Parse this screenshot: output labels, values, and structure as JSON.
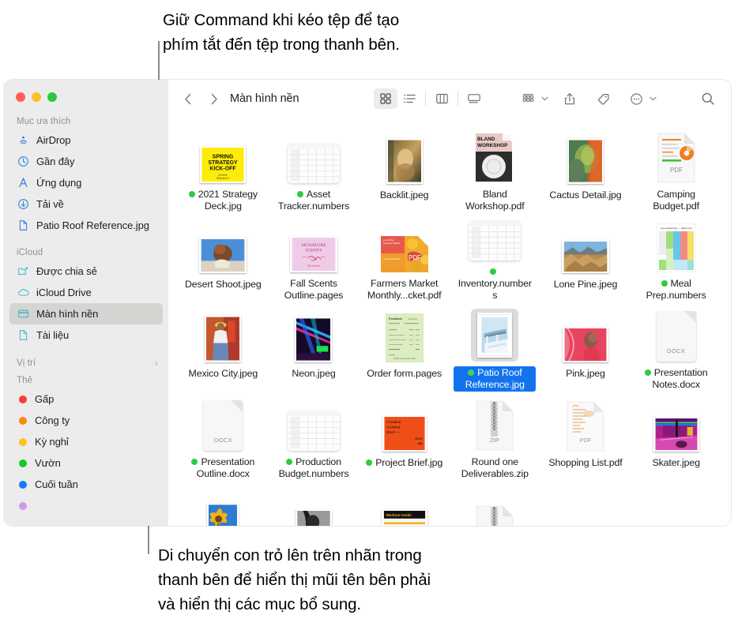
{
  "callouts": {
    "top": "Giữ Command khi kéo tệp để tạo\nphím tắt đến tệp trong thanh bên.",
    "bottom": "Di chuyển con trỏ lên trên nhãn trong\nthanh bên để hiển thị mũi tên bên phải\nvà hiển thị các mục bổ sung."
  },
  "window": {
    "traffic_lights": [
      "close",
      "minimize",
      "zoom"
    ]
  },
  "sidebar": {
    "sections": [
      {
        "header": "Mục ưa thích",
        "has_chevron": false,
        "items": [
          {
            "label": "AirDrop",
            "icon": "airdrop-icon",
            "selected": false
          },
          {
            "label": "Gần đây",
            "icon": "clock-icon",
            "selected": false
          },
          {
            "label": "Ứng dụng",
            "icon": "applications-icon",
            "selected": false
          },
          {
            "label": "Tải về",
            "icon": "downloads-icon",
            "selected": false
          },
          {
            "label": "Patio Roof Reference.jpg",
            "icon": "document-icon",
            "selected": false
          }
        ]
      },
      {
        "header": "iCloud",
        "has_chevron": false,
        "items": [
          {
            "label": "Được chia sẻ",
            "icon": "shared-folder-icon",
            "selected": false
          },
          {
            "label": "iCloud Drive",
            "icon": "cloud-icon",
            "selected": false
          },
          {
            "label": "Màn hình nền",
            "icon": "desktop-icon",
            "selected": true
          },
          {
            "label": "Tài liệu",
            "icon": "document-icon",
            "selected": false
          }
        ]
      },
      {
        "header": "Vị trí",
        "has_chevron": true,
        "items": []
      },
      {
        "header": "Thẻ",
        "has_chevron": false,
        "items": [
          {
            "label": "Gấp",
            "icon": "tag-dot",
            "color": "#fc3b30",
            "selected": false
          },
          {
            "label": "Công ty",
            "icon": "tag-dot",
            "color": "#fc8a0b",
            "selected": false
          },
          {
            "label": "Kỳ nghỉ",
            "icon": "tag-dot",
            "color": "#fcc41e",
            "selected": false
          },
          {
            "label": "Vườn",
            "icon": "tag-dot",
            "color": "#16c82a",
            "selected": false
          },
          {
            "label": "Cuối tuần",
            "icon": "tag-dot",
            "color": "#147cfa",
            "selected": false
          }
        ]
      }
    ]
  },
  "toolbar": {
    "back_icon": "chevron-left-icon",
    "forward_icon": "chevron-right-icon",
    "path_title": "Màn hình nền",
    "view_buttons": [
      {
        "name": "icon-view",
        "icon": "grid-view-icon",
        "active": true
      },
      {
        "name": "list-view",
        "icon": "list-view-icon",
        "active": false
      },
      {
        "name": "column-view",
        "icon": "column-view-icon",
        "active": false
      },
      {
        "name": "gallery-view",
        "icon": "gallery-view-icon",
        "active": false
      }
    ],
    "action_buttons": [
      {
        "name": "group-by",
        "icon": "group-by-icon",
        "caret": true
      },
      {
        "name": "share",
        "icon": "share-icon",
        "caret": false
      },
      {
        "name": "tags",
        "icon": "tag-icon",
        "caret": false
      },
      {
        "name": "more-actions",
        "icon": "ellipsis-circle-icon",
        "caret": true
      }
    ],
    "search_icon": "search-icon"
  },
  "files": [
    {
      "name": "2021 Strategy Deck.jpg",
      "kind": "image-yellow-deck",
      "tag": "#2ecc40",
      "selected": false
    },
    {
      "name": "Asset Tracker.numbers",
      "kind": "numbers",
      "tag": "#2ecc40",
      "selected": false
    },
    {
      "name": "Backlit.jpeg",
      "kind": "photo-backlit",
      "tag": null,
      "selected": false
    },
    {
      "name": "Bland Workshop.pdf",
      "kind": "pdf-bland-workshop",
      "tag": null,
      "selected": false
    },
    {
      "name": "Cactus Detail.jpg",
      "kind": "photo-cactus",
      "tag": null,
      "selected": false
    },
    {
      "name": "Camping Budget.pdf",
      "kind": "pdf-chart",
      "tag": null,
      "selected": false
    },
    {
      "name": "Desert Shoot.jpeg",
      "kind": "photo-desert",
      "tag": null,
      "selected": false
    },
    {
      "name": "Fall Scents Outline.pages",
      "kind": "pages-signature-scents",
      "tag": null,
      "selected": false
    },
    {
      "name": "Farmers Market Monthly...cket.pdf",
      "kind": "pdf-farmers-market",
      "tag": null,
      "selected": false
    },
    {
      "name": "Inventory.numbers",
      "kind": "numbers",
      "tag": "#2ecc40",
      "selected": false
    },
    {
      "name": "Lone Pine.jpeg",
      "kind": "photo-lonepine",
      "tag": null,
      "selected": false
    },
    {
      "name": "Meal Prep.numbers",
      "kind": "numbers-mealprep",
      "tag": "#2ecc40",
      "selected": false
    },
    {
      "name": "Mexico City.jpeg",
      "kind": "photo-mexico",
      "tag": null,
      "selected": false
    },
    {
      "name": "Neon.jpeg",
      "kind": "photo-neon",
      "tag": null,
      "selected": false
    },
    {
      "name": "Order form.pages",
      "kind": "pages-orderform",
      "tag": null,
      "selected": false
    },
    {
      "name": "Patio Roof Reference.jpg",
      "kind": "photo-patio",
      "tag": "#45d35a",
      "selected": true
    },
    {
      "name": "Pink.jpeg",
      "kind": "photo-pink",
      "tag": null,
      "selected": false
    },
    {
      "name": "Presentation Notes.docx",
      "kind": "docx",
      "tag": "#2ecc40",
      "selected": false
    },
    {
      "name": "Presentation Outline.docx",
      "kind": "docx",
      "tag": "#2ecc40",
      "selected": false
    },
    {
      "name": "Production Budget.numbers",
      "kind": "numbers",
      "tag": "#2ecc40",
      "selected": false
    },
    {
      "name": "Project Brief.jpg",
      "kind": "image-orange-brief",
      "tag": "#2ecc40",
      "selected": false
    },
    {
      "name": "Round one Deliverables.zip",
      "kind": "zip",
      "tag": null,
      "selected": false
    },
    {
      "name": "Shopping List.pdf",
      "kind": "pdf-shopping-list",
      "tag": null,
      "selected": false
    },
    {
      "name": "Skater.jpeg",
      "kind": "photo-skater",
      "tag": null,
      "selected": false
    },
    {
      "name": "",
      "kind": "photo-sunflower",
      "tag": null,
      "selected": false
    },
    {
      "name": "",
      "kind": "photo-bw",
      "tag": null,
      "selected": false
    },
    {
      "name": "",
      "kind": "doc-workout",
      "tag": null,
      "selected": false
    },
    {
      "name": "",
      "kind": "zip",
      "tag": null,
      "selected": false
    }
  ],
  "thumb_labels": {
    "deck_line1": "SPRING",
    "deck_line2": "STRATEGY",
    "deck_line3": "KICK-OFF",
    "deck_sub": "Creative Brainstorm",
    "scents_line1": "SIGNATURE",
    "scents_line2": "SCENTS",
    "brief_line1": "Creative",
    "brief_line2": "Content",
    "brief_line3": "Brief —",
    "brief_date1": "June",
    "brief_date2": "4th",
    "workshop_line1": "BLAND",
    "workshop_line2": "WORKSHOP",
    "pdf_label": "PDF",
    "zip_label": "ZIP",
    "docx_label": "DOCX",
    "mealprep_title": "Lone Meal Prep — Week One",
    "workout_title": "Workout Guide"
  }
}
